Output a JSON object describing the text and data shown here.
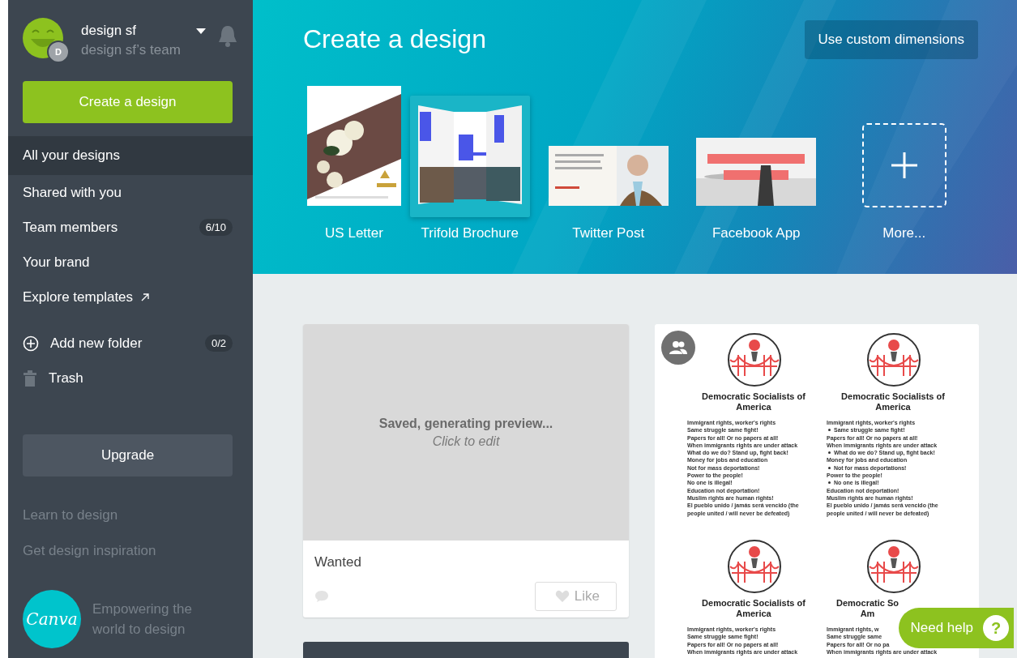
{
  "sidebar": {
    "user": {
      "name": "design sf",
      "team": "design sf’s team",
      "badge": "D"
    },
    "create_button": "Create a design",
    "nav": [
      {
        "label": "All your designs",
        "selected": true,
        "kind": "link"
      },
      {
        "label": "Shared with you",
        "selected": false,
        "kind": "link"
      },
      {
        "label": "Team members",
        "selected": false,
        "kind": "link",
        "count": "6/10"
      },
      {
        "label": "Your brand",
        "selected": false,
        "kind": "link"
      },
      {
        "label": "Explore templates",
        "selected": false,
        "kind": "external"
      }
    ],
    "folders": [
      {
        "label": "Add new folder",
        "kind": "add",
        "count": "0/2"
      },
      {
        "label": "Trash",
        "kind": "trash"
      }
    ],
    "upgrade_button": "Upgrade",
    "links": [
      "Learn to design",
      "Get design inspiration"
    ],
    "logo": "Canva",
    "tagline": "Empowering the world to design"
  },
  "header": {
    "title": "Create a design",
    "custom_button": "Use custom dimensions",
    "templates": [
      {
        "label": "US Letter",
        "kind": "portrait",
        "selected": false
      },
      {
        "label": "Trifold Brochure",
        "kind": "brochure",
        "selected": true
      },
      {
        "label": "Twitter Post",
        "kind": "wide",
        "selected": false
      },
      {
        "label": "Facebook App",
        "kind": "banner",
        "selected": false
      },
      {
        "label": "More...",
        "kind": "more",
        "selected": false
      }
    ]
  },
  "designs": [
    {
      "kind": "pending",
      "status": "Saved, generating preview...",
      "hint": "Click to edit",
      "title": "Wanted",
      "like": "Like"
    },
    {
      "kind": "flyer",
      "shared": true,
      "blocks": [
        {
          "title": "Democratic Socialists of America",
          "lines": [
            {
              "text": "Immigrant rights, worker's rights",
              "bullet": false
            },
            {
              "text": "Same struggle same fight!",
              "bullet": false
            },
            {
              "text": "Papers for all! Or no papers at all!",
              "bullet": false
            },
            {
              "text": "When immigrants rights are under attack",
              "bullet": false
            },
            {
              "text": "What do we do? Stand up, fight back!",
              "bullet": false
            },
            {
              "text": "Money for jobs and education",
              "bullet": false
            },
            {
              "text": "Not for mass deportations!",
              "bullet": false
            },
            {
              "text": "Power to the people!",
              "bullet": false
            },
            {
              "text": "No one is illegal!",
              "bullet": false
            },
            {
              "text": "Education not deportation!",
              "bullet": false
            },
            {
              "text": "Muslim rights are human rights!",
              "bullet": false
            },
            {
              "text": "El pueblo unido / jamás será vencido (the people united / will never be defeated)",
              "bullet": false
            }
          ]
        },
        {
          "title": "Democratic Socialists of America",
          "lines": [
            {
              "text": "Immigrant rights, worker's rights",
              "bullet": false
            },
            {
              "text": "Same struggle same fight!",
              "bullet": true
            },
            {
              "text": "Papers for all! Or no papers at all!",
              "bullet": false
            },
            {
              "text": "When immigrants rights are under attack",
              "bullet": false
            },
            {
              "text": "What do we do? Stand up, fight back!",
              "bullet": true
            },
            {
              "text": "Money for jobs and education",
              "bullet": false
            },
            {
              "text": "Not for mass deportations!",
              "bullet": true
            },
            {
              "text": "Power to the people!",
              "bullet": false
            },
            {
              "text": "No one is illegal!",
              "bullet": true
            },
            {
              "text": "Education not deportation!",
              "bullet": false
            },
            {
              "text": "Muslim rights are human rights!",
              "bullet": false
            },
            {
              "text": "El pueblo unido / jamás será vencido (the people united / will never be defeated)",
              "bullet": false
            }
          ]
        },
        {
          "title": "Democratic Socialists of America",
          "lines": [
            {
              "text": "Immigrant rights, worker's rights",
              "bullet": false
            },
            {
              "text": "Same struggle same fight!",
              "bullet": false
            },
            {
              "text": "Papers for all! Or no papers at all!",
              "bullet": false
            },
            {
              "text": "When immigrants rights are under attack",
              "bullet": false
            }
          ]
        },
        {
          "title": "Democratic So\nAm",
          "lines": [
            {
              "text": "Immigrant rights, w",
              "bullet": false
            },
            {
              "text": "Same struggle same",
              "bullet": false
            },
            {
              "text": "Papers for all! Or no pa",
              "bullet": false
            },
            {
              "text": "When immigrants rights are under attack",
              "bullet": false
            }
          ]
        }
      ]
    }
  ],
  "help_button": {
    "label": "Need help",
    "icon": "?"
  }
}
